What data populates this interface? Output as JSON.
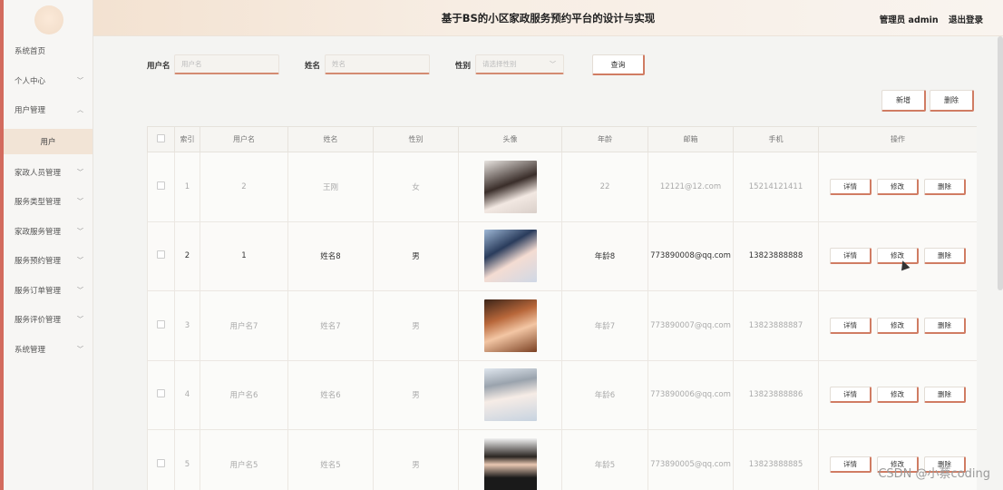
{
  "header": {
    "title": "基于BS的小区家政服务预约平台的设计与实现",
    "user_label": "管理员 admin",
    "logout": "退出登录"
  },
  "sidebar": {
    "items": [
      {
        "label": "系统首页"
      },
      {
        "label": "个人中心"
      },
      {
        "label": "用户管理"
      },
      {
        "label": "用户"
      },
      {
        "label": "家政人员管理"
      },
      {
        "label": "服务类型管理"
      },
      {
        "label": "家政服务管理"
      },
      {
        "label": "服务预约管理"
      },
      {
        "label": "服务订单管理"
      },
      {
        "label": "服务评价管理"
      },
      {
        "label": "系统管理"
      }
    ]
  },
  "search": {
    "username_label": "用户名",
    "username_placeholder": "用户名",
    "name_label": "姓名",
    "name_placeholder": "姓名",
    "gender_label": "性别",
    "gender_placeholder": "请选择性别",
    "query_button": "查询"
  },
  "actions": {
    "add": "新增",
    "delete": "删除"
  },
  "table": {
    "headers": [
      "",
      "索引",
      "用户名",
      "姓名",
      "性别",
      "头像",
      "年龄",
      "邮箱",
      "手机",
      "操作"
    ],
    "rows": [
      {
        "index": "1",
        "username": "2",
        "name": "王刚",
        "gender": "女",
        "age": "22",
        "email": "12121@12.com",
        "phone": "15214121411"
      },
      {
        "index": "2",
        "username": "1",
        "name": "姓名8",
        "gender": "男",
        "age": "年龄8",
        "email": "773890008@qq.com",
        "phone": "13823888888"
      },
      {
        "index": "3",
        "username": "用户名7",
        "name": "姓名7",
        "gender": "男",
        "age": "年龄7",
        "email": "773890007@qq.com",
        "phone": "13823888887"
      },
      {
        "index": "4",
        "username": "用户名6",
        "name": "姓名6",
        "gender": "男",
        "age": "年龄6",
        "email": "773890006@qq.com",
        "phone": "13823888886"
      },
      {
        "index": "5",
        "username": "用户名5",
        "name": "姓名5",
        "gender": "男",
        "age": "年龄5",
        "email": "773890005@qq.com",
        "phone": "13823888885"
      }
    ],
    "op_labels": {
      "detail": "详情",
      "edit": "修改",
      "delete": "删除"
    }
  },
  "watermark": "CSDN @小蔡coding",
  "colors": {
    "accent": "#d07c63",
    "sidebar_border": "#d36b5e",
    "header_bg": "#f3e2d1"
  }
}
